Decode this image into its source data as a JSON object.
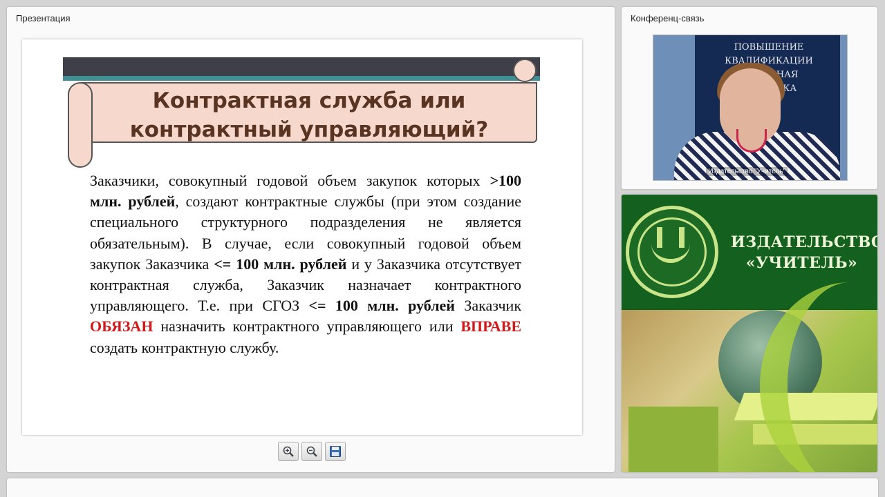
{
  "presentation_panel": {
    "title": "Презентация"
  },
  "slide": {
    "title_line1": "Контрактная служба или",
    "title_line2": "контрактный управляющий?",
    "body": {
      "p1": "Заказчики, совокупный годовой объем закупок которых ",
      "b1": ">100 млн. рублей",
      "p2": ", создают контрактные службы (при этом создание специального структурного подразделения не является обязательным). В случае, если совокупный годовой объем закупок Заказчика ",
      "b2": "<= 100 млн. рублей",
      "p3": " и у Заказчика отсутствует контрактная служба, Заказчик назначает контрактного управляющего. Т.е. при СГОЗ ",
      "b3": "<= 100 млн. рублей",
      "p4": " Заказчик ",
      "red1": "ОБЯЗАН",
      "p5": " назначить контрактного управляющего или ",
      "red2": "ВПРАВЕ",
      "p6": " создать контрактную службу."
    }
  },
  "toolbar": {
    "zoom_in_icon": "zoom-in-icon",
    "zoom_out_icon": "zoom-out-icon",
    "save_icon": "floppy-disk-icon"
  },
  "conference_panel": {
    "title": "Конференц-связь",
    "video_label": "Издательство \"Учитель\"",
    "banner_text_line1": "ПОВЫШЕНИЕ",
    "banner_text_line2": "КВАЛИФИКАЦИИ",
    "banner_text_line3": "П...АЛЬНАЯ",
    "banner_text_line4": "...ГОТОВКА"
  },
  "ad_panel": {
    "title_line1": "ИЗДАТЕЛЬСТВО",
    "title_line2": "«УЧИТЕЛЬ»"
  },
  "colors": {
    "accent_red": "#d01a1a",
    "scroll_fill": "#f6d8cc",
    "title_brown": "#5a3422",
    "ad_green": "#13601f"
  }
}
